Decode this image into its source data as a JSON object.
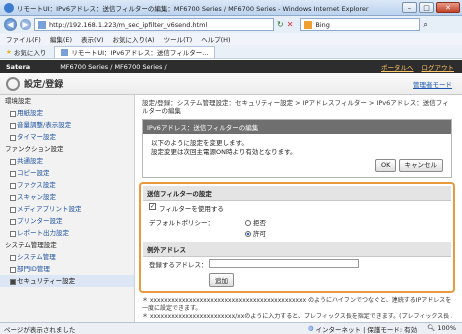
{
  "window": {
    "title": "リモートUI：IPv6アドレス：送信フィルターの編集：MF6700 Series / MF6700 Series - Windows Internet Explorer",
    "controls": [
      "–",
      "□",
      "✕"
    ]
  },
  "address_bar": {
    "url": "http://192.168.1.223/m_sec_ipfilter_v6send.html",
    "search_engine": "Bing"
  },
  "menu": [
    "ファイル(F)",
    "編集(E)",
    "表示(V)",
    "お気に入り(A)",
    "ツール(T)",
    "ヘルプ(H)"
  ],
  "favorites": {
    "label": "お気に入り",
    "tab": "リモートUI：IPv6アドレス：送信フィルター..."
  },
  "app": {
    "brand": "Satera",
    "product": "MF6700 Series / MF6700 Series /",
    "portal_link": "ポータルへ",
    "logout_link": "ログアウト",
    "page_title": "設定/登録",
    "admin_label": "管理者モード"
  },
  "sidebar": {
    "sections": [
      {
        "label": "環境設定",
        "items": [
          "用紙設定",
          "音量調整/表示設定",
          "タイマー設定"
        ]
      },
      {
        "label": "ファンクション設定",
        "items": [
          "共通設定",
          "コピー設定",
          "ファクス設定",
          "スキャン設定",
          "メディアプリント設定",
          "プリンター設定",
          "レポート出力設定"
        ]
      },
      {
        "label": "システム管理設定",
        "items": [
          "システム管理",
          "部門ID管理",
          "セキュリティー設定"
        ]
      }
    ],
    "selected": "セキュリティー設定"
  },
  "main": {
    "breadcrumb": "設定/登録：システム管理設定：セキュリティー設定 > IPアドレスフィルター > IPv6アドレス：送信フィルターの編集",
    "edit_box": {
      "header": "IPv6アドレス：送信フィルターの編集",
      "line1": "以下のように設定を変更します。",
      "line2": "設定変更は次回主電源ON時より有効となります。",
      "ok_label": "OK",
      "cancel_label": "キャンセル"
    },
    "filter": {
      "header": "送信フィルターの設定",
      "use_filter_label": "フィルターを使用する",
      "use_filter_checked": true,
      "default_policy_label": "デフォルトポリシー：",
      "policy_options": [
        "拒否",
        "許可"
      ],
      "policy_selected": "許可"
    },
    "exceptions": {
      "header": "例外アドレス",
      "register_label": "登録するアドレス：",
      "register_value": "",
      "add_button": "追加"
    },
    "notes": [
      "＊ xxxxxxxxxxxxxxxxxxxxxxxxxxxxxxxxxxxxxxxxxxxx のようにハイフンでつなぐと、連続するIPアドレスを一度に設定できます。",
      "＊ xxxxxxxxxxxxxxxxxxxxxxxx/xxのように入力すると、プレフィックス長を指定できます。(プレフィックス長 ..."
    ]
  },
  "status_bar": {
    "left": "ページが表示されました",
    "zone": "インターネット | 保護モード: 有効",
    "zoom": "100%"
  }
}
